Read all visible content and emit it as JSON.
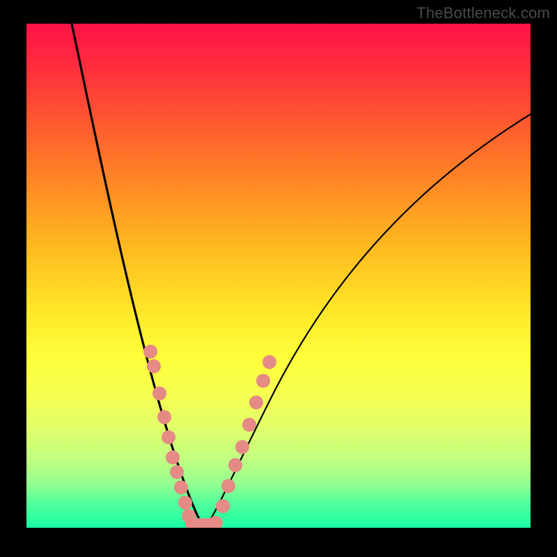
{
  "watermark": "TheBottleneck.com",
  "chart_data": {
    "type": "line",
    "title": "",
    "xlabel": "",
    "ylabel": "",
    "xlim": [
      0,
      100
    ],
    "ylim": [
      0,
      100
    ],
    "grid": false,
    "legend": false,
    "gradient_colors_top_to_bottom": [
      "#ff1147",
      "#ff5a2f",
      "#ffb81f",
      "#feff3a",
      "#18ffa4"
    ],
    "series": [
      {
        "name": "left-curve",
        "color": "#000000",
        "x": [
          9,
          12,
          15,
          18,
          21,
          24,
          27,
          30,
          32,
          34,
          35
        ],
        "y": [
          100,
          87,
          74,
          62,
          50,
          39,
          28,
          17,
          8,
          2,
          0
        ]
      },
      {
        "name": "right-curve",
        "color": "#000000",
        "x": [
          35,
          38,
          42,
          47,
          53,
          60,
          68,
          77,
          87,
          100
        ],
        "y": [
          0,
          5,
          13,
          24,
          36,
          48,
          58,
          67,
          75,
          82
        ]
      }
    ],
    "marker_clusters": [
      {
        "name": "left-branch-dots",
        "color": "#e58a84",
        "x": [
          24.5,
          25.2,
          26.3,
          27.3,
          28.2,
          29.0,
          29.8,
          30.6,
          31.4,
          32.1
        ],
        "y": [
          35,
          32,
          27,
          22,
          18,
          14,
          11,
          8,
          5,
          2
        ]
      },
      {
        "name": "valley-dots",
        "color": "#e58a84",
        "x": [
          32.8,
          33.9,
          35.0,
          36.2,
          37.4
        ],
        "y": [
          0.6,
          0.4,
          0.3,
          0.5,
          1
        ]
      },
      {
        "name": "right-branch-dots",
        "color": "#e58a84",
        "x": [
          38.8,
          40.0,
          41.3,
          42.6,
          43.9,
          45.2,
          46.5,
          47.8
        ],
        "y": [
          5,
          9,
          13,
          17,
          21,
          25,
          29,
          33
        ]
      }
    ],
    "valley_x": 35
  }
}
